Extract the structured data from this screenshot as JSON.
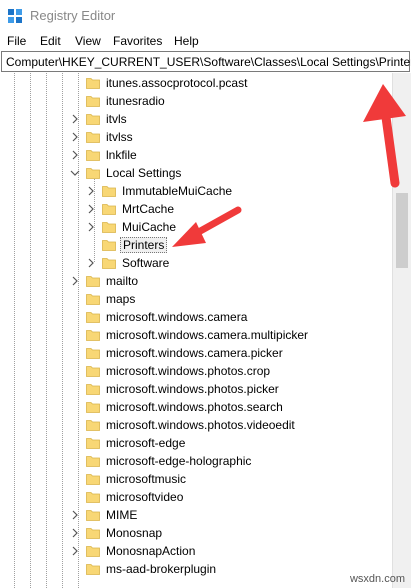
{
  "window": {
    "title": "Registry Editor"
  },
  "menu": [
    "File",
    "Edit",
    "View",
    "Favorites",
    "Help"
  ],
  "address": {
    "path": "Computer\\HKEY_CURRENT_USER\\Software\\Classes\\Local Settings\\Printers"
  },
  "tree": {
    "items": [
      {
        "label": "itunes.assocprotocol.pcast",
        "level": 0,
        "expander": "none"
      },
      {
        "label": "itunesradio",
        "level": 0,
        "expander": "none"
      },
      {
        "label": "itvls",
        "level": 0,
        "expander": "collapsed"
      },
      {
        "label": "itvlss",
        "level": 0,
        "expander": "collapsed"
      },
      {
        "label": "lnkfile",
        "level": 0,
        "expander": "collapsed"
      },
      {
        "label": "Local Settings",
        "level": 0,
        "expander": "expanded"
      },
      {
        "label": "ImmutableMuiCache",
        "level": 1,
        "expander": "collapsed"
      },
      {
        "label": "MrtCache",
        "level": 1,
        "expander": "collapsed"
      },
      {
        "label": "MuiCache",
        "level": 1,
        "expander": "collapsed"
      },
      {
        "label": "Printers",
        "level": 1,
        "expander": "none",
        "selected": true
      },
      {
        "label": "Software",
        "level": 1,
        "expander": "collapsed"
      },
      {
        "label": "mailto",
        "level": 0,
        "expander": "collapsed"
      },
      {
        "label": "maps",
        "level": 0,
        "expander": "none"
      },
      {
        "label": "microsoft.windows.camera",
        "level": 0,
        "expander": "none"
      },
      {
        "label": "microsoft.windows.camera.multipicker",
        "level": 0,
        "expander": "none"
      },
      {
        "label": "microsoft.windows.camera.picker",
        "level": 0,
        "expander": "none"
      },
      {
        "label": "microsoft.windows.photos.crop",
        "level": 0,
        "expander": "none"
      },
      {
        "label": "microsoft.windows.photos.picker",
        "level": 0,
        "expander": "none"
      },
      {
        "label": "microsoft.windows.photos.search",
        "level": 0,
        "expander": "none"
      },
      {
        "label": "microsoft.windows.photos.videoedit",
        "level": 0,
        "expander": "none"
      },
      {
        "label": "microsoft-edge",
        "level": 0,
        "expander": "none"
      },
      {
        "label": "microsoft-edge-holographic",
        "level": 0,
        "expander": "none"
      },
      {
        "label": "microsoftmusic",
        "level": 0,
        "expander": "none"
      },
      {
        "label": "microsoftvideo",
        "level": 0,
        "expander": "none"
      },
      {
        "label": "MIME",
        "level": 0,
        "expander": "collapsed"
      },
      {
        "label": "Monosnap",
        "level": 0,
        "expander": "collapsed"
      },
      {
        "label": "MonosnapAction",
        "level": 0,
        "expander": "collapsed"
      },
      {
        "label": "ms-aad-brokerplugin",
        "level": 0,
        "expander": "none"
      }
    ]
  },
  "watermark": "wsxdn.com",
  "colors": {
    "folder": "#f8d775",
    "folder_edge": "#d9b44a",
    "arrow": "#f03a3a"
  }
}
